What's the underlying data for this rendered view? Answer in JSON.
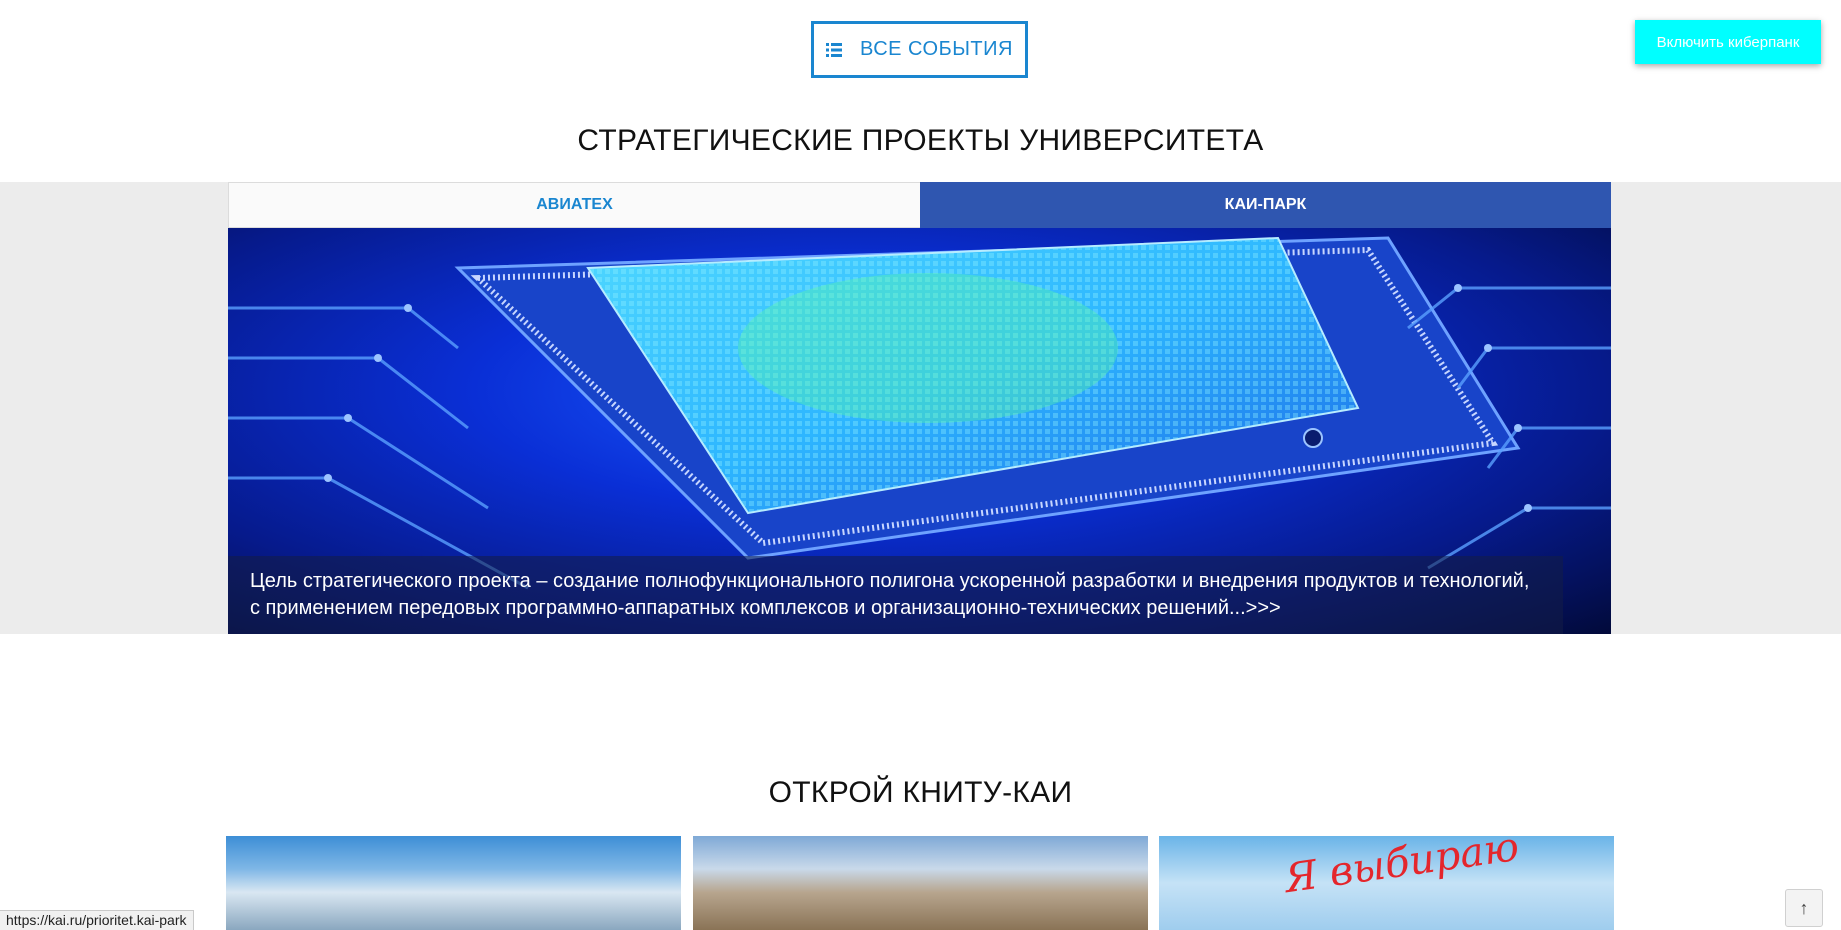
{
  "header": {
    "all_events_label": "ВСЕ СОБЫТИЯ",
    "all_events_icon": "list-icon",
    "cyberpunk_label": "Включить киберпанк"
  },
  "strategic": {
    "title": "СТРАТЕГИЧЕСКИЕ ПРОЕКТЫ УНИВЕРСИТЕТА",
    "tabs": [
      {
        "label": "АВИАТЕХ",
        "active": false
      },
      {
        "label": "КАИ-ПАРК",
        "active": true
      }
    ],
    "caption": "Цель стратегического проекта – создание полнофункционального полигона ускоренной разработки и внедрения продуктов и технологий, с применением передовых программно-аппаратных комплексов и организационно-технических решений...>>>"
  },
  "open_section": {
    "title": "ОТКРОЙ КНИТУ-КАИ",
    "cards": [
      {
        "name": "city-aerial-photo"
      },
      {
        "name": "campus-buildings-photo"
      },
      {
        "name": "students-photo",
        "overlay_text": "Я выбираю"
      }
    ]
  },
  "status_bar": {
    "url": "https://kai.ru/prioritet.kai-park"
  },
  "scroll_top_symbol": "↑",
  "colors": {
    "accent_blue": "#1a86d0",
    "active_tab": "#2f56b0",
    "cyberpunk_button": "#00ffff"
  }
}
